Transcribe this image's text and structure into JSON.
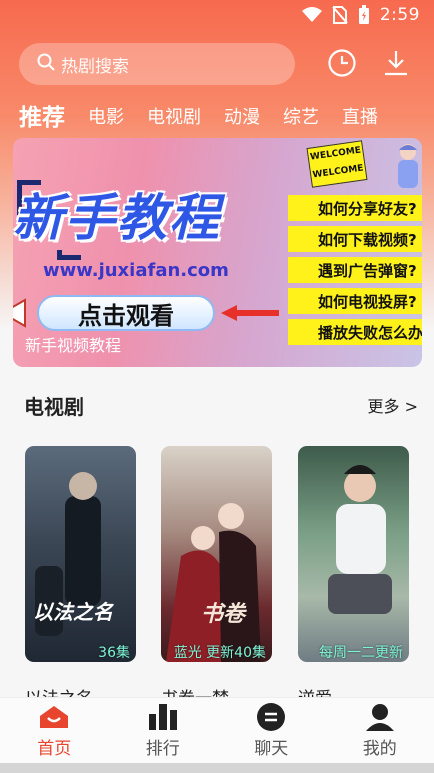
{
  "status_bar": {
    "time": "2:59"
  },
  "search": {
    "placeholder": "热剧搜索"
  },
  "tabs": [
    {
      "label": "推荐",
      "active": true
    },
    {
      "label": "电影"
    },
    {
      "label": "电视剧"
    },
    {
      "label": "动漫"
    },
    {
      "label": "综艺"
    },
    {
      "label": "直播"
    }
  ],
  "banner": {
    "title": "新手教程",
    "url": "www.juxiafan.com",
    "cta": "点击观看",
    "caption": "新手视频教程",
    "welcome_top": "WELCOME",
    "welcome_bottom": "WELCOME",
    "faq": [
      "如何分享好友?",
      "如何下载视频?",
      "遇到广告弹窗?",
      "如何电视投屏?",
      "播放失败怎么办"
    ]
  },
  "section": {
    "title": "电视剧",
    "more": "更多 >"
  },
  "cards": [
    {
      "title": "以法之名",
      "badge": "36集",
      "poster_text": "以法之名"
    },
    {
      "title": "书卷一梦",
      "badge": "蓝光 更新40集",
      "poster_text": "书卷"
    },
    {
      "title": "逆爱",
      "badge": "每周一二更新"
    }
  ],
  "bottom_nav": [
    {
      "label": "首页",
      "icon": "home-icon",
      "active": true
    },
    {
      "label": "排行",
      "icon": "ranking-icon"
    },
    {
      "label": "聊天",
      "icon": "chat-icon"
    },
    {
      "label": "我的",
      "icon": "profile-icon"
    }
  ],
  "colors": {
    "accent": "#e8452e",
    "header_top": "#f76a4f",
    "badge": "#7df4d5",
    "faq_bg": "#fff21a"
  }
}
